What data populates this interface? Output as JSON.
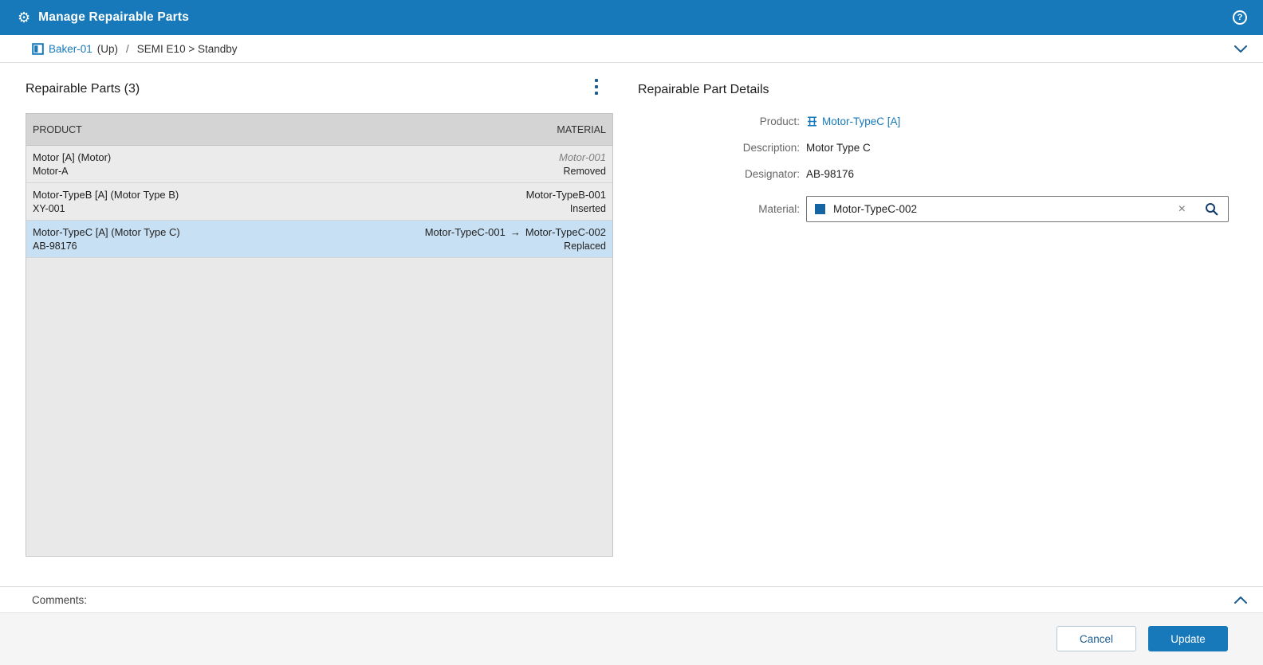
{
  "colors": {
    "accent": "#1779ba",
    "link": "#1779ba",
    "selected_row": "#c8e0f3",
    "table_header_bg": "#d4d4d4",
    "row_bg": "#ebebeb"
  },
  "glyphs": {
    "gear": "⚙",
    "help": "?",
    "clear": "×"
  },
  "header": {
    "title": "Manage Repairable Parts"
  },
  "breadcrumb": {
    "equipment": "Baker-01",
    "up_label": "(Up)",
    "separator": "/",
    "path": "SEMI E10 > Standby"
  },
  "parts": {
    "title": "Repairable Parts (3)",
    "columns": [
      "PRODUCT",
      "MATERIAL"
    ],
    "rows": [
      {
        "product": "Motor [A] (Motor)",
        "designator": "Motor-A",
        "material": "Motor-001",
        "status": "Removed"
      },
      {
        "product": "Motor-TypeB [A] (Motor Type B)",
        "designator": "XY-001",
        "material": "Motor-TypeB-001",
        "status": "Inserted"
      },
      {
        "product": "Motor-TypeC [A] (Motor Type C)",
        "designator": "AB-98176",
        "material_from": "Motor-TypeC-001",
        "material_arrow": "→",
        "material_to": "Motor-TypeC-002",
        "status": "Replaced"
      }
    ]
  },
  "details": {
    "title": "Repairable Part Details",
    "product_label": "Product:",
    "product_value": "Motor-TypeC [A]",
    "description_label": "Description:",
    "description_value": "Motor Type C",
    "designator_label": "Designator:",
    "designator_value": "AB-98176",
    "material_label": "Material:",
    "material_value": "Motor-TypeC-002"
  },
  "comments": {
    "label": "Comments:"
  },
  "footer": {
    "cancel_label": "Cancel",
    "update_label": "Update"
  }
}
